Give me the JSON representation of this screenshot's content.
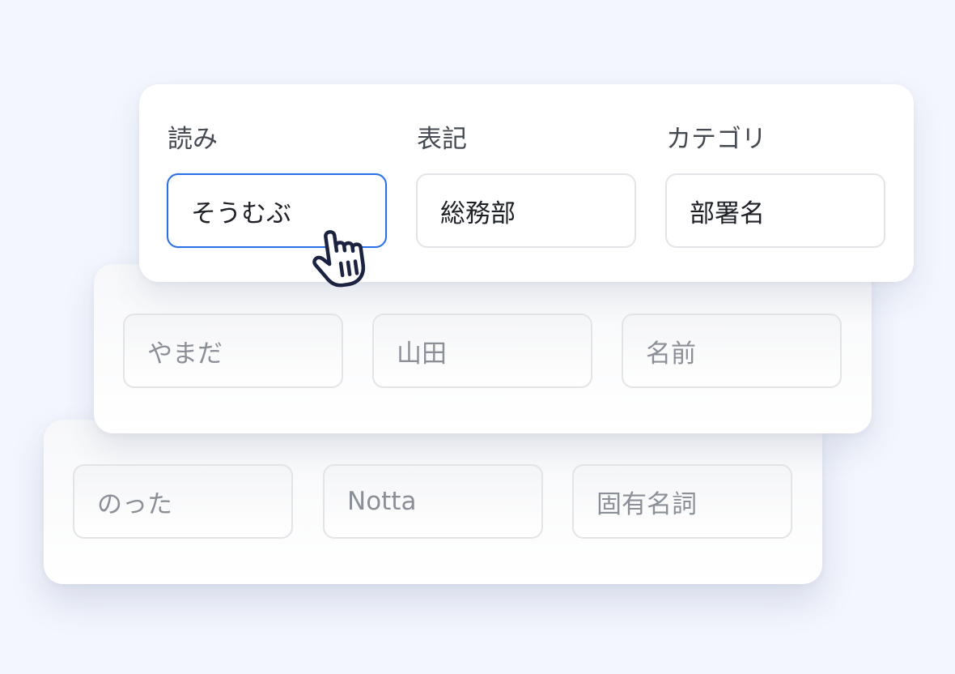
{
  "headers": {
    "reading": "読み",
    "notation": "表記",
    "category": "カテゴリ"
  },
  "rows": [
    {
      "reading": "そうむぶ",
      "notation": "総務部",
      "category": "部署名"
    },
    {
      "reading": "やまだ",
      "notation": "山田",
      "category": "名前"
    },
    {
      "reading": "のった",
      "notation": "Notta",
      "category": "固有名詞"
    }
  ],
  "colors": {
    "background": "#f3f6fd",
    "accent_focus": "#2b6fe6",
    "field_border": "#e3e4e7",
    "text_primary": "#1d2026",
    "text_faded": "#8b8f97"
  },
  "icons": {
    "cursor": "hand-pointer-icon"
  }
}
